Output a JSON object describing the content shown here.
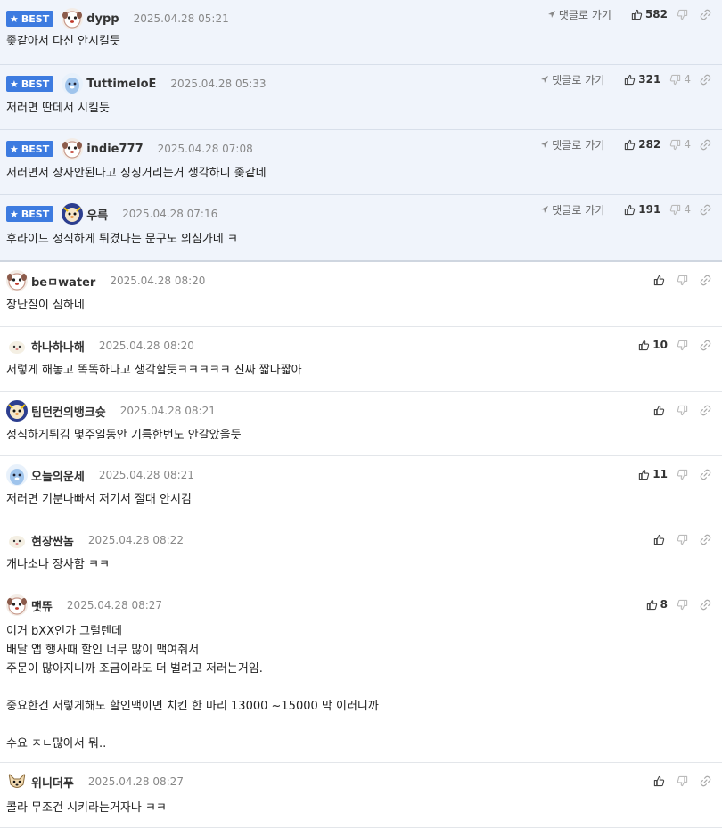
{
  "reply_label": "댓글로 가기",
  "best_label": "BEST",
  "accent_color": "#3d7be0",
  "comments": [
    {
      "best": true,
      "nick": "dypp",
      "date": "2025.04.28 05:21",
      "text": "좆같아서 다신 안시킬듯",
      "likes": "582",
      "dislikes": ""
    },
    {
      "best": true,
      "nick": "TuttimeloE",
      "date": "2025.04.28 05:33",
      "text": "저러면 딴데서 시킬듯",
      "likes": "321",
      "dislikes": "4"
    },
    {
      "best": true,
      "nick": "indie777",
      "date": "2025.04.28 07:08",
      "text": "저러면서 장사안된다고 징징거리는거 생각하니 좆같네",
      "likes": "282",
      "dislikes": "4"
    },
    {
      "best": true,
      "nick": "우륵",
      "date": "2025.04.28 07:16",
      "text": "후라이드 정직하게 튀겼다는 문구도 의심가네 ㅋ",
      "likes": "191",
      "dislikes": "4"
    },
    {
      "best": false,
      "nick": "beㅁwater",
      "date": "2025.04.28 08:20",
      "text": "장난질이 심하네",
      "likes": "",
      "dislikes": ""
    },
    {
      "best": false,
      "nick": "하나하나해",
      "date": "2025.04.28 08:20",
      "text": "저렇게 해놓고 똑똑하다고 생각할듯ㅋㅋㅋㅋㅋ 진짜 짧다짧아",
      "likes": "10",
      "dislikes": ""
    },
    {
      "best": false,
      "nick": "팀던컨의뱅크슛",
      "date": "2025.04.28 08:21",
      "text": "정직하게튀김 몇주일동안 기름한번도 안갈았을듯",
      "likes": "",
      "dislikes": ""
    },
    {
      "best": false,
      "nick": "오늘의운세",
      "date": "2025.04.28 08:21",
      "text": "저러면 기분나빠서 저기서 절대 안시킴",
      "likes": "11",
      "dislikes": ""
    },
    {
      "best": false,
      "nick": "현장싼놈",
      "date": "2025.04.28 08:22",
      "text": "개나소나 장사함 ㅋㅋ",
      "likes": "",
      "dislikes": ""
    },
    {
      "best": false,
      "nick": "맷뜌",
      "date": "2025.04.28 08:27",
      "text": "이거 bXX인가 그럴텐데\n배달 앱 행사때 할인 너무 많이 맥여줘서\n주문이 많아지니까 조금이라도 더 벌려고 저러는거임.\n\n중요한건 저렇게해도 할인맥이면 치킨 한 마리 13000 ~15000 막 이러니까\n\n수요 ㅈㄴ많아서 뭐..",
      "likes": "8",
      "dislikes": ""
    },
    {
      "best": false,
      "nick": "위니더푸",
      "date": "2025.04.28 08:27",
      "text": "콜라 무조건 시키라는거자나 ㅋㅋ",
      "likes": "",
      "dislikes": ""
    }
  ]
}
